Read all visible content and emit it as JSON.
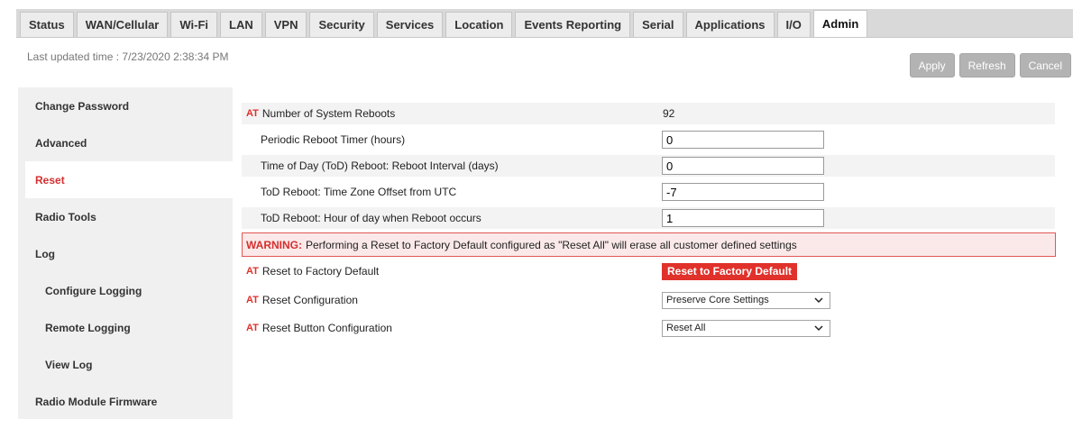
{
  "tabs": [
    {
      "label": "Status"
    },
    {
      "label": "WAN/Cellular"
    },
    {
      "label": "Wi-Fi"
    },
    {
      "label": "LAN"
    },
    {
      "label": "VPN"
    },
    {
      "label": "Security"
    },
    {
      "label": "Services"
    },
    {
      "label": "Location"
    },
    {
      "label": "Events Reporting"
    },
    {
      "label": "Serial"
    },
    {
      "label": "Applications"
    },
    {
      "label": "I/O"
    },
    {
      "label": "Admin"
    }
  ],
  "header": {
    "last_updated": "Last updated time : 7/23/2020 2:38:34 PM",
    "apply": "Apply",
    "refresh": "Refresh",
    "cancel": "Cancel"
  },
  "sidebar": {
    "items": [
      {
        "label": "Change Password"
      },
      {
        "label": "Advanced"
      },
      {
        "label": "Reset"
      },
      {
        "label": "Radio Tools"
      },
      {
        "label": "Log"
      },
      {
        "label": "Configure Logging"
      },
      {
        "label": "Remote Logging"
      },
      {
        "label": "View Log"
      },
      {
        "label": "Radio Module Firmware"
      }
    ]
  },
  "content": {
    "at_tag": "AT",
    "reboots_label": "Number of System Reboots",
    "reboots_value": "92",
    "periodic_label": "Periodic Reboot Timer (hours)",
    "periodic_value": "0",
    "tod_interval_label": "Time of Day (ToD) Reboot: Reboot Interval (days)",
    "tod_interval_value": "0",
    "tz_offset_label": "ToD Reboot: Time Zone Offset from UTC",
    "tz_offset_value": "-7",
    "hour_label": "ToD Reboot: Hour of day when Reboot occurs",
    "hour_value": "1",
    "warning_label": "WARNING:",
    "warning_text": "Performing a Reset to Factory Default configured as \"Reset All\" will erase all customer defined settings",
    "factory_label": "Reset to Factory Default",
    "factory_button": "Reset to Factory Default",
    "reset_config_label": "Reset Configuration",
    "reset_config_value": "Preserve Core Settings",
    "reset_button_label": "Reset Button Configuration",
    "reset_button_value": "Reset All"
  },
  "colors": {
    "accent_red": "#e0312b",
    "tab_bar": "#d9d9d9",
    "panel_bg": "#f0f0f0"
  }
}
